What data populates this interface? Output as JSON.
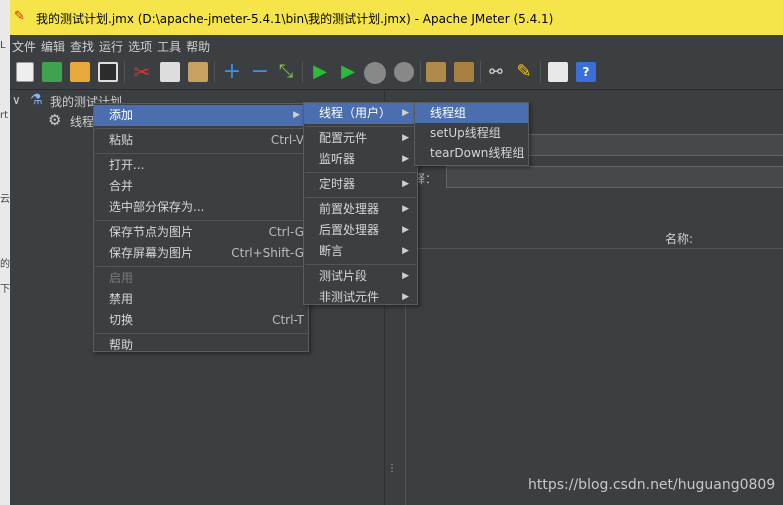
{
  "window": {
    "title": "我的测试计划.jmx (D:\\apache-jmeter-5.4.1\\bin\\我的测试计划.jmx) - Apache JMeter (5.4.1)"
  },
  "menubar": [
    "文件",
    "编辑",
    "查找",
    "运行",
    "选项",
    "工具",
    "帮助"
  ],
  "toolbar": {
    "icons": [
      "new-icon",
      "templates-icon",
      "open-icon",
      "save-icon",
      "cut-icon",
      "copy-icon",
      "paste-icon",
      "expand-icon",
      "collapse-icon",
      "toggle-icon",
      "start-icon",
      "start-no-pause-icon",
      "stop-icon",
      "shutdown-icon",
      "clear-icon",
      "clear-all-icon",
      "search-icon",
      "reset-search-icon",
      "function-helper-icon",
      "help-icon"
    ]
  },
  "tree": {
    "root": "我的测试计划",
    "child": "线程"
  },
  "context_menu": {
    "items": [
      {
        "label": "添加",
        "accel": "",
        "submenu": true,
        "selected": true,
        "disabled": false
      },
      {
        "sep": true
      },
      {
        "label": "粘贴",
        "accel": "Ctrl-V",
        "submenu": false,
        "selected": false,
        "disabled": false
      },
      {
        "sep": true
      },
      {
        "label": "打开...",
        "accel": "",
        "submenu": false,
        "selected": false,
        "disabled": false
      },
      {
        "label": "合并",
        "accel": "",
        "submenu": false,
        "selected": false,
        "disabled": false
      },
      {
        "label": "选中部分保存为...",
        "accel": "",
        "submenu": false,
        "selected": false,
        "disabled": false
      },
      {
        "sep": true
      },
      {
        "label": "保存节点为图片",
        "accel": "Ctrl-G",
        "submenu": false,
        "selected": false,
        "disabled": false
      },
      {
        "label": "保存屏幕为图片",
        "accel": "Ctrl+Shift-G",
        "submenu": false,
        "selected": false,
        "disabled": false
      },
      {
        "sep": true
      },
      {
        "label": "启用",
        "accel": "",
        "submenu": false,
        "selected": false,
        "disabled": true
      },
      {
        "label": "禁用",
        "accel": "",
        "submenu": false,
        "selected": false,
        "disabled": false
      },
      {
        "label": "切换",
        "accel": "Ctrl-T",
        "submenu": false,
        "selected": false,
        "disabled": false
      },
      {
        "sep": true
      },
      {
        "label": "帮助",
        "accel": "",
        "submenu": false,
        "selected": false,
        "disabled": false
      }
    ]
  },
  "add_submenu": {
    "items": [
      {
        "label": "线程（用户）",
        "selected": true
      },
      {
        "sep": true
      },
      {
        "label": "配置元件",
        "selected": false
      },
      {
        "label": "监听器",
        "selected": false
      },
      {
        "sep": true
      },
      {
        "label": "定时器",
        "selected": false
      },
      {
        "sep": true
      },
      {
        "label": "前置处理器",
        "selected": false
      },
      {
        "label": "后置处理器",
        "selected": false
      },
      {
        "label": "断言",
        "selected": false
      },
      {
        "sep": true
      },
      {
        "label": "测试片段",
        "selected": false
      },
      {
        "label": "非测试元件",
        "selected": false
      }
    ]
  },
  "threads_submenu": {
    "items": [
      {
        "label": "线程组",
        "selected": true
      },
      {
        "label": "setUp线程组",
        "selected": false
      },
      {
        "label": "tearDown线程组",
        "selected": false
      }
    ]
  },
  "right_panel": {
    "comment_label": "释：",
    "column_header": "名称:"
  },
  "watermark": "https://blog.csdn.net/huguang0809",
  "colors": {
    "selected": "#4b6eaf",
    "title_bar": "#f5e44a",
    "background": "#3c3f41"
  }
}
